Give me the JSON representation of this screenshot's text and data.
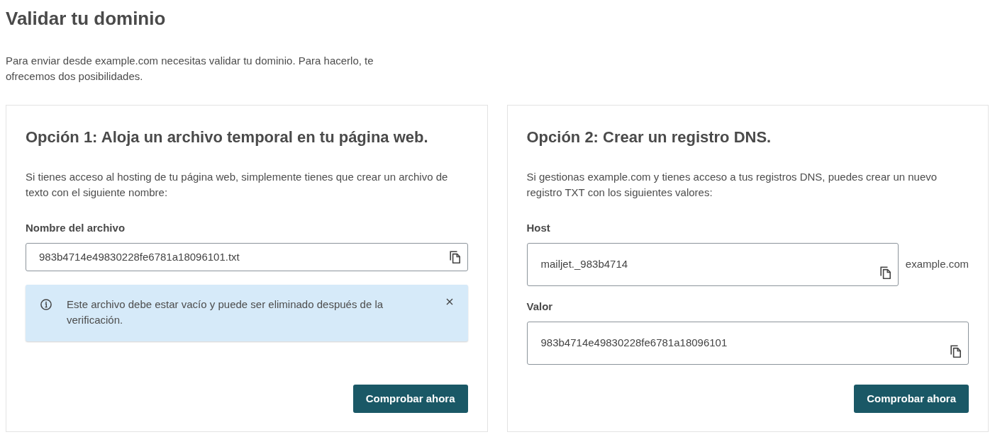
{
  "page": {
    "title": "Validar tu dominio",
    "intro": "Para enviar desde example.com necesitas validar tu dominio. Para hacerlo, te ofrecemos dos posibilidades."
  },
  "options": [
    {
      "title": "Opción 1: Aloja un archivo temporal en tu página web.",
      "description": "Si tienes acceso al hosting de tu página web, simplemente tienes que crear un archivo de texto con el siguiente nombre:",
      "fields": [
        {
          "kind": "line",
          "label": "Nombre del archivo",
          "value": "983b4714e49830228fe6781a18096101.txt"
        }
      ],
      "alert": {
        "text": "Este archivo debe estar vacío y puede ser eliminado después de la verificación."
      },
      "button": "Comprobar ahora"
    },
    {
      "title": "Opción 2: Crear un registro DNS.",
      "description": "Si gestionas example.com y tienes acceso a tus registros DNS, puedes crear un nuevo registro TXT con los siguientes valores:",
      "fields": [
        {
          "kind": "box",
          "label": "Host",
          "value": "mailjet._983b4714",
          "suffix": "example.com"
        },
        {
          "kind": "box",
          "label": "Valor",
          "value": "983b4714e49830228fe6781a18096101"
        }
      ],
      "button": "Comprobar ahora"
    }
  ]
}
